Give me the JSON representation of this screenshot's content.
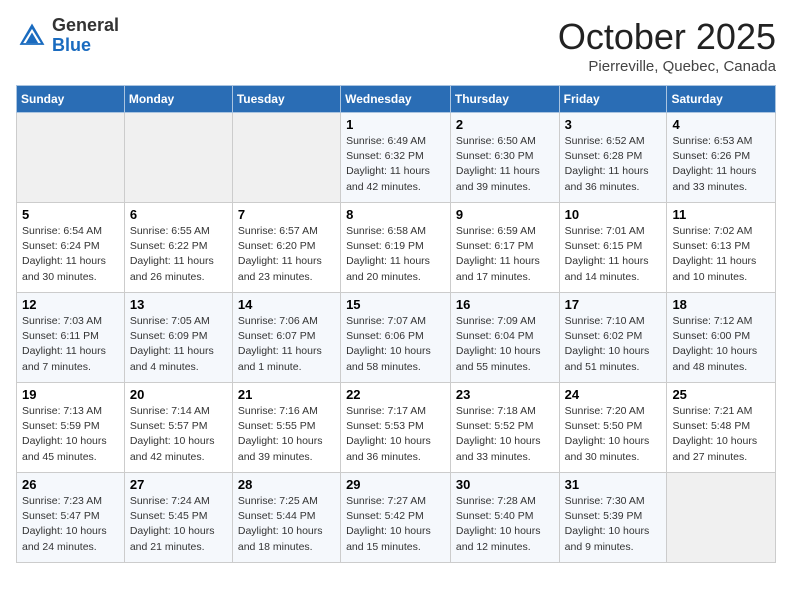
{
  "header": {
    "logo_general": "General",
    "logo_blue": "Blue",
    "month_title": "October 2025",
    "location": "Pierreville, Quebec, Canada"
  },
  "weekdays": [
    "Sunday",
    "Monday",
    "Tuesday",
    "Wednesday",
    "Thursday",
    "Friday",
    "Saturday"
  ],
  "weeks": [
    [
      {
        "day": "",
        "info": ""
      },
      {
        "day": "",
        "info": ""
      },
      {
        "day": "",
        "info": ""
      },
      {
        "day": "1",
        "info": "Sunrise: 6:49 AM\nSunset: 6:32 PM\nDaylight: 11 hours\nand 42 minutes."
      },
      {
        "day": "2",
        "info": "Sunrise: 6:50 AM\nSunset: 6:30 PM\nDaylight: 11 hours\nand 39 minutes."
      },
      {
        "day": "3",
        "info": "Sunrise: 6:52 AM\nSunset: 6:28 PM\nDaylight: 11 hours\nand 36 minutes."
      },
      {
        "day": "4",
        "info": "Sunrise: 6:53 AM\nSunset: 6:26 PM\nDaylight: 11 hours\nand 33 minutes."
      }
    ],
    [
      {
        "day": "5",
        "info": "Sunrise: 6:54 AM\nSunset: 6:24 PM\nDaylight: 11 hours\nand 30 minutes."
      },
      {
        "day": "6",
        "info": "Sunrise: 6:55 AM\nSunset: 6:22 PM\nDaylight: 11 hours\nand 26 minutes."
      },
      {
        "day": "7",
        "info": "Sunrise: 6:57 AM\nSunset: 6:20 PM\nDaylight: 11 hours\nand 23 minutes."
      },
      {
        "day": "8",
        "info": "Sunrise: 6:58 AM\nSunset: 6:19 PM\nDaylight: 11 hours\nand 20 minutes."
      },
      {
        "day": "9",
        "info": "Sunrise: 6:59 AM\nSunset: 6:17 PM\nDaylight: 11 hours\nand 17 minutes."
      },
      {
        "day": "10",
        "info": "Sunrise: 7:01 AM\nSunset: 6:15 PM\nDaylight: 11 hours\nand 14 minutes."
      },
      {
        "day": "11",
        "info": "Sunrise: 7:02 AM\nSunset: 6:13 PM\nDaylight: 11 hours\nand 10 minutes."
      }
    ],
    [
      {
        "day": "12",
        "info": "Sunrise: 7:03 AM\nSunset: 6:11 PM\nDaylight: 11 hours\nand 7 minutes."
      },
      {
        "day": "13",
        "info": "Sunrise: 7:05 AM\nSunset: 6:09 PM\nDaylight: 11 hours\nand 4 minutes."
      },
      {
        "day": "14",
        "info": "Sunrise: 7:06 AM\nSunset: 6:07 PM\nDaylight: 11 hours\nand 1 minute."
      },
      {
        "day": "15",
        "info": "Sunrise: 7:07 AM\nSunset: 6:06 PM\nDaylight: 10 hours\nand 58 minutes."
      },
      {
        "day": "16",
        "info": "Sunrise: 7:09 AM\nSunset: 6:04 PM\nDaylight: 10 hours\nand 55 minutes."
      },
      {
        "day": "17",
        "info": "Sunrise: 7:10 AM\nSunset: 6:02 PM\nDaylight: 10 hours\nand 51 minutes."
      },
      {
        "day": "18",
        "info": "Sunrise: 7:12 AM\nSunset: 6:00 PM\nDaylight: 10 hours\nand 48 minutes."
      }
    ],
    [
      {
        "day": "19",
        "info": "Sunrise: 7:13 AM\nSunset: 5:59 PM\nDaylight: 10 hours\nand 45 minutes."
      },
      {
        "day": "20",
        "info": "Sunrise: 7:14 AM\nSunset: 5:57 PM\nDaylight: 10 hours\nand 42 minutes."
      },
      {
        "day": "21",
        "info": "Sunrise: 7:16 AM\nSunset: 5:55 PM\nDaylight: 10 hours\nand 39 minutes."
      },
      {
        "day": "22",
        "info": "Sunrise: 7:17 AM\nSunset: 5:53 PM\nDaylight: 10 hours\nand 36 minutes."
      },
      {
        "day": "23",
        "info": "Sunrise: 7:18 AM\nSunset: 5:52 PM\nDaylight: 10 hours\nand 33 minutes."
      },
      {
        "day": "24",
        "info": "Sunrise: 7:20 AM\nSunset: 5:50 PM\nDaylight: 10 hours\nand 30 minutes."
      },
      {
        "day": "25",
        "info": "Sunrise: 7:21 AM\nSunset: 5:48 PM\nDaylight: 10 hours\nand 27 minutes."
      }
    ],
    [
      {
        "day": "26",
        "info": "Sunrise: 7:23 AM\nSunset: 5:47 PM\nDaylight: 10 hours\nand 24 minutes."
      },
      {
        "day": "27",
        "info": "Sunrise: 7:24 AM\nSunset: 5:45 PM\nDaylight: 10 hours\nand 21 minutes."
      },
      {
        "day": "28",
        "info": "Sunrise: 7:25 AM\nSunset: 5:44 PM\nDaylight: 10 hours\nand 18 minutes."
      },
      {
        "day": "29",
        "info": "Sunrise: 7:27 AM\nSunset: 5:42 PM\nDaylight: 10 hours\nand 15 minutes."
      },
      {
        "day": "30",
        "info": "Sunrise: 7:28 AM\nSunset: 5:40 PM\nDaylight: 10 hours\nand 12 minutes."
      },
      {
        "day": "31",
        "info": "Sunrise: 7:30 AM\nSunset: 5:39 PM\nDaylight: 10 hours\nand 9 minutes."
      },
      {
        "day": "",
        "info": ""
      }
    ]
  ]
}
